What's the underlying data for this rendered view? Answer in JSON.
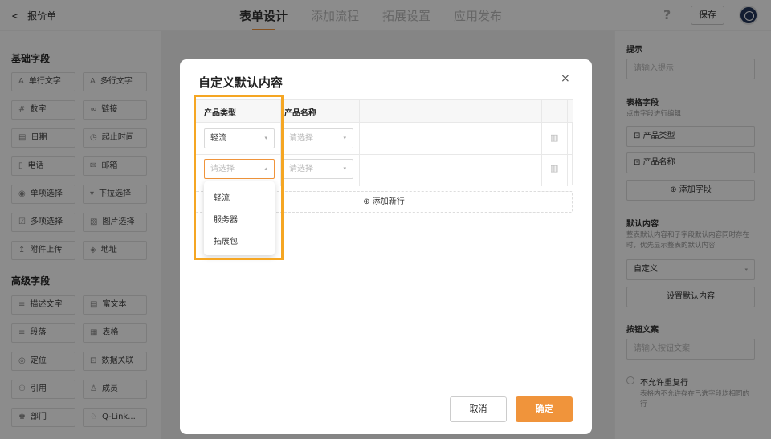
{
  "header": {
    "back_label": "报价单",
    "tabs": [
      {
        "label": "表单设计"
      },
      {
        "label": "添加流程"
      },
      {
        "label": "拓展设置"
      },
      {
        "label": "应用发布"
      }
    ],
    "help_label": "?",
    "save_label": "保存"
  },
  "left_panel": {
    "basic_title": "基础字段",
    "basic_fields": [
      {
        "label": "单行文字"
      },
      {
        "label": "多行文字"
      },
      {
        "label": "数字"
      },
      {
        "label": "链接"
      },
      {
        "label": "日期"
      },
      {
        "label": "起止时间"
      },
      {
        "label": "电话"
      },
      {
        "label": "邮箱"
      },
      {
        "label": "单项选择"
      },
      {
        "label": "下拉选择"
      },
      {
        "label": "多项选择"
      },
      {
        "label": "图片选择"
      },
      {
        "label": "附件上传"
      },
      {
        "label": "地址"
      }
    ],
    "advanced_title": "高级字段",
    "advanced_fields": [
      {
        "label": "描述文字"
      },
      {
        "label": "富文本"
      },
      {
        "label": "段落"
      },
      {
        "label": "表格"
      },
      {
        "label": "定位"
      },
      {
        "label": "数据关联"
      },
      {
        "label": "引用"
      },
      {
        "label": "成员"
      },
      {
        "label": "部门"
      },
      {
        "label": "Q-Link..."
      }
    ]
  },
  "right_panel": {
    "hint_label": "提示",
    "hint_placeholder": "请输入提示",
    "table_fields_label": "表格字段",
    "table_fields_sub": "点击字段进行编辑",
    "table_fields": [
      {
        "label": "产品类型"
      },
      {
        "label": "产品名称"
      }
    ],
    "add_field_label": "添加字段",
    "default_label": "默认内容",
    "default_sub": "整表默认内容和子字段默认内容同时存在时，优先显示整表的默认内容",
    "default_value": "自定义",
    "set_default_button": "设置默认内容",
    "button_text_label": "按钮文案",
    "button_text_placeholder": "请输入按钮文案",
    "no_repeat_label": "不允许重复行",
    "no_repeat_sub": "表格内不允许存在已选字段均相同的行"
  },
  "modal": {
    "title": "自定义默认内容",
    "close_label": "×",
    "columns": [
      "产品类型",
      "产品名称"
    ],
    "rows": [
      {
        "type": "轻流",
        "name_placeholder": "请选择"
      },
      {
        "type_placeholder": "请选择",
        "name_placeholder": "请选择"
      }
    ],
    "add_row_label": "添加新行",
    "dropdown_options": [
      {
        "label": "轻流"
      },
      {
        "label": "服务器"
      },
      {
        "label": "拓展包"
      }
    ],
    "cancel_label": "取消",
    "ok_label": "确定"
  }
}
